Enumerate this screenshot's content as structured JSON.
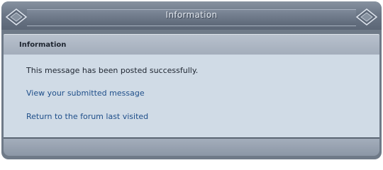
{
  "window": {
    "title": "Information"
  },
  "header": {
    "label": "Information"
  },
  "content": {
    "message": "This message has been posted successfully.",
    "links": [
      {
        "label": "View your submitted message"
      },
      {
        "label": "Return to the forum last visited"
      }
    ]
  },
  "colors": {
    "link": "#1f4f8a",
    "content_background": "#d0dbe6",
    "frame": "#6f7a88"
  },
  "icons": {
    "left": "diamond-ornament-icon",
    "right": "diamond-ornament-icon"
  }
}
